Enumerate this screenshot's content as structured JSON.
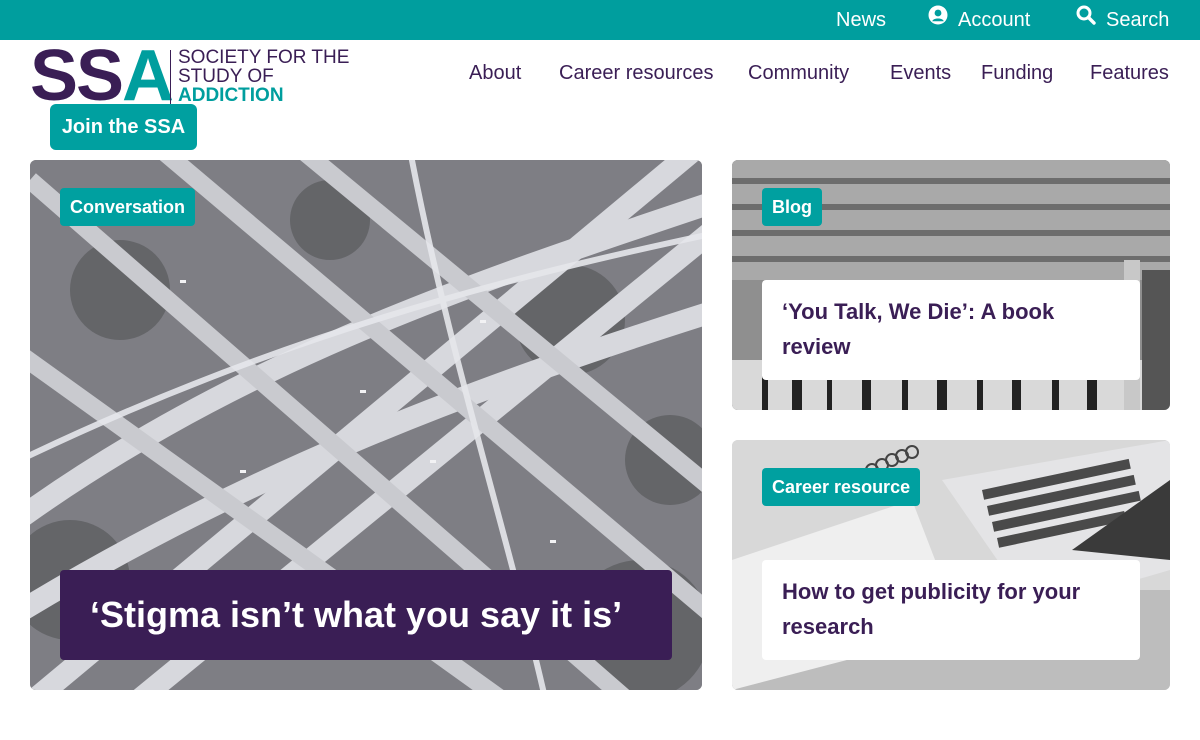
{
  "topbar": {
    "news_label": "News",
    "account_label": "Account",
    "search_label": "Search"
  },
  "logo": {
    "mark_s": "SS",
    "mark_a": "A",
    "line1": "SOCIETY FOR THE",
    "line2": "STUDY OF",
    "line3": "ADDICTION"
  },
  "join_label": "Join the SSA",
  "nav": {
    "items": [
      "About",
      "Career resources",
      "Community",
      "Events",
      "Funding",
      "Features"
    ]
  },
  "cards": {
    "feature": {
      "tag": "Conversation",
      "title": "‘Stigma isn’t what you say it is’"
    },
    "blog": {
      "tag": "Blog",
      "title": "‘You Talk, We Die’: A book review"
    },
    "career": {
      "tag": "Career resource",
      "title": "How to get publicity for your research"
    }
  },
  "colors": {
    "brand_teal": "#009e9e",
    "brand_purple": "#3a1e55",
    "white": "#ffffff"
  },
  "icons": [
    "account-icon",
    "search-icon"
  ]
}
